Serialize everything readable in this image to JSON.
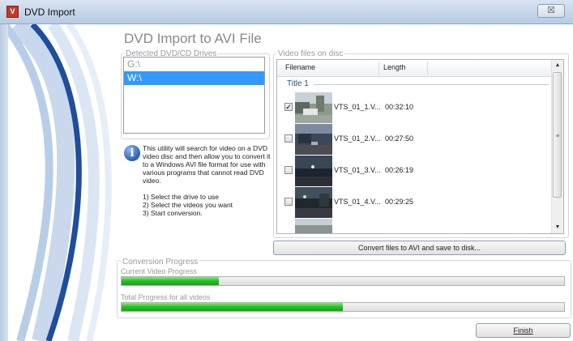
{
  "window": {
    "title": "DVD Import",
    "app_icon_glyph": "V",
    "close_glyph": "☒"
  },
  "heading": "DVD Import to AVI File",
  "drives": {
    "label": "Detected DVD/CD Drives",
    "items": [
      {
        "label": "G:\\",
        "selected": false
      },
      {
        "label": "W:\\",
        "selected": true
      }
    ]
  },
  "info": {
    "text": "This utility will search for video on a DVD video disc and then allow you to convert it to a Windows AVI file format for use with various programs that cannot read DVD video.",
    "step1": "1) Select the drive to use",
    "step2": "2) Select the videos you want",
    "step3": "3) Start conversion."
  },
  "videos": {
    "label": "Video files on disc",
    "col_filename": "Filename",
    "col_length": "Length",
    "group": "Title 1",
    "rows": [
      {
        "name": "VTS_01_1.V...",
        "length": "00:32:10",
        "checked": true
      },
      {
        "name": "VTS_01_2.V...",
        "length": "00:27:50",
        "checked": false
      },
      {
        "name": "VTS_01_3.V...",
        "length": "00:26:19",
        "checked": false
      },
      {
        "name": "VTS_01_4.V...",
        "length": "00:29:25",
        "checked": false
      }
    ],
    "scroll_up": "▲",
    "scroll_down": "▼",
    "scroll_grip": "≡"
  },
  "convert_button": "Convert files to AVI and save to disk...",
  "progress": {
    "label": "Conversion Progress",
    "current_label": "Current Video Progress",
    "current_fraction": 0.22,
    "total_label": "Total Progress for all videos",
    "total_fraction": 0.5
  },
  "finish_button": "Finish",
  "colors": {
    "accent": "#3399ff",
    "progress": "#22c022",
    "decor_dark": "#1e4e9c",
    "decor_light": "#b8cde8"
  }
}
